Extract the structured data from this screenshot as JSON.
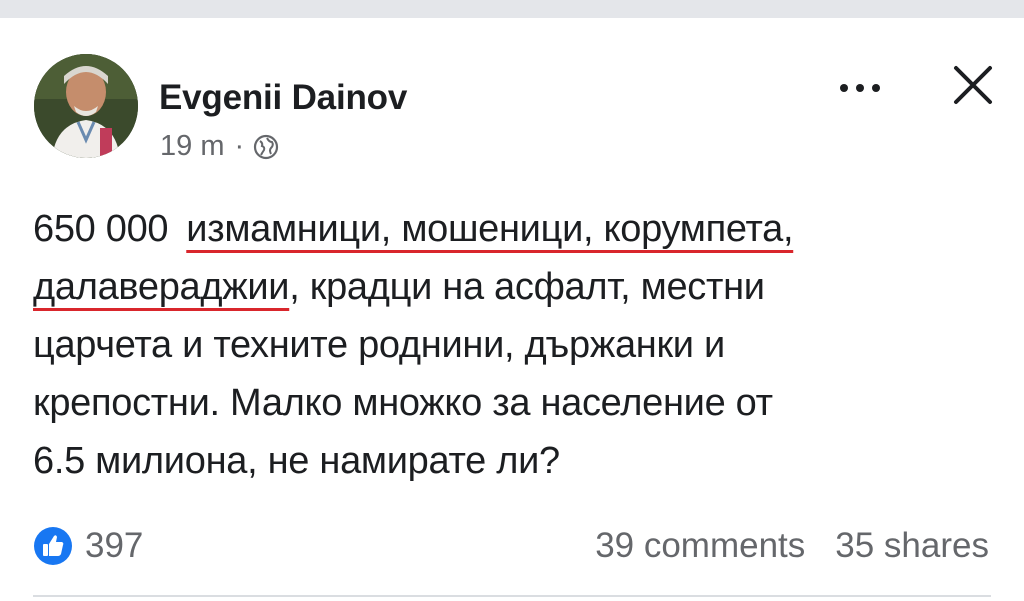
{
  "post": {
    "author": "Evgenii Dainov",
    "time": "19 m",
    "separator": "·",
    "privacy_icon": "globe-icon",
    "body": {
      "line1_prefix": "650 000",
      "line1_underlined": "измамници, мошеници, корумпета,",
      "line2_underlined": "далавераджии",
      "line2_rest": ", крадци на асфалт, местни",
      "line3": "царчета и техните роднини, държанки и",
      "line4": "крепостни. Малко множко за население от",
      "line5": "6.5 милиона, не намирате ли?"
    },
    "underline_color": "#d9262c"
  },
  "reactions": {
    "icon": "like-icon",
    "count": "397"
  },
  "stats": {
    "comments": "39 comments",
    "shares": "35 shares"
  },
  "colors": {
    "accent": "#1877f2",
    "text": "#1c1e21",
    "secondary": "#65676b"
  }
}
